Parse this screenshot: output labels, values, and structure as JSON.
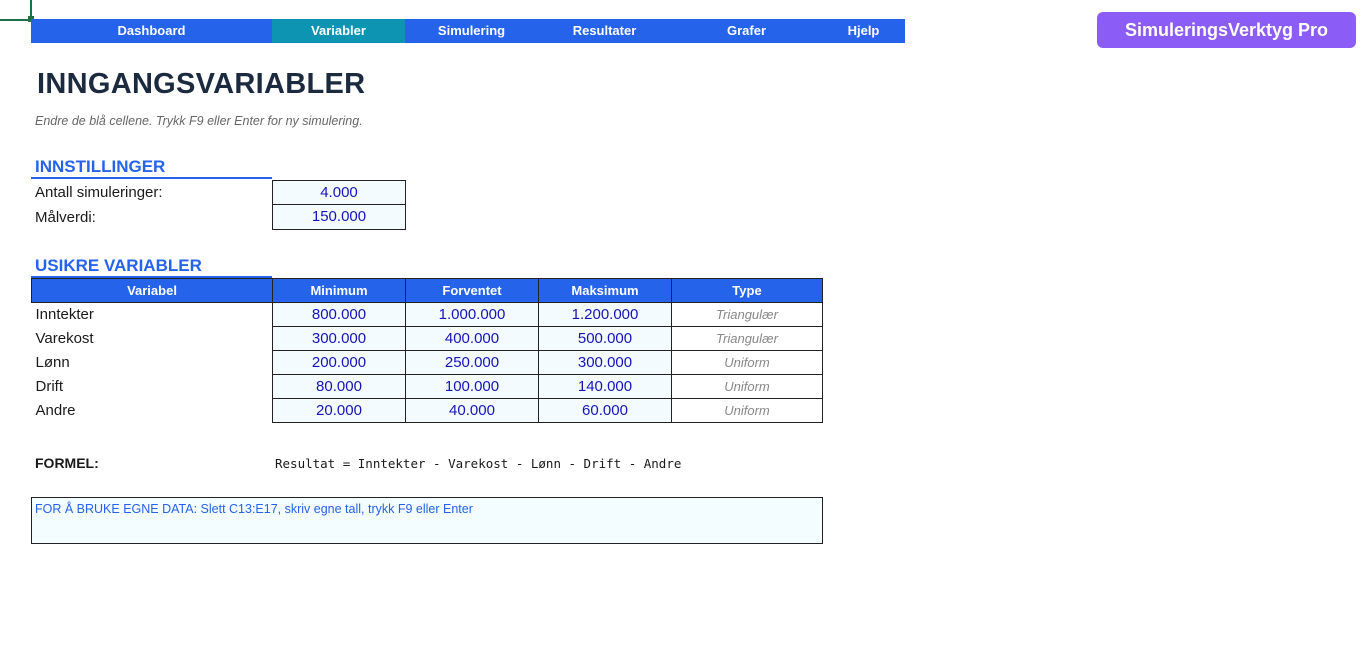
{
  "nav": {
    "items": [
      {
        "label": "Dashboard"
      },
      {
        "label": "Variabler"
      },
      {
        "label": "Simulering"
      },
      {
        "label": "Resultater"
      },
      {
        "label": "Grafer"
      },
      {
        "label": "Hjelp"
      }
    ],
    "active": "Variabler"
  },
  "brand": "SimuleringsVerktyg Pro",
  "page": {
    "title": "INNGANGSVARIABLER",
    "subtitle": "Endre de blå cellene. Trykk F9 eller Enter for ny simulering."
  },
  "settings": {
    "title": "INNSTILLINGER",
    "rows": [
      {
        "label": "Antall simuleringer:",
        "value": "4.000"
      },
      {
        "label": "Målverdi:",
        "value": "150.000"
      }
    ]
  },
  "variables": {
    "title": "USIKRE VARIABLER",
    "headers": [
      "Variabel",
      "Minimum",
      "Forventet",
      "Maksimum",
      "Type"
    ],
    "rows": [
      {
        "name": "Inntekter",
        "min": "800.000",
        "expected": "1.000.000",
        "max": "1.200.000",
        "type": "Triangulær"
      },
      {
        "name": "Varekost",
        "min": "300.000",
        "expected": "400.000",
        "max": "500.000",
        "type": "Triangulær"
      },
      {
        "name": "Lønn",
        "min": "200.000",
        "expected": "250.000",
        "max": "300.000",
        "type": "Uniform"
      },
      {
        "name": "Drift",
        "min": "80.000",
        "expected": "100.000",
        "max": "140.000",
        "type": "Uniform"
      },
      {
        "name": "Andre",
        "min": "20.000",
        "expected": "40.000",
        "max": "60.000",
        "type": "Uniform"
      }
    ]
  },
  "formula": {
    "label": "FORMEL:",
    "text": "Resultat = Inntekter - Varekost - Lønn - Drift - Andre"
  },
  "note": "FOR Å BRUKE EGNE DATA: Slett C13:E17, skriv egne tall, trykk F9 eller Enter",
  "colors": {
    "accent": "#2563eb",
    "nav_active": "#0e94b3",
    "brand": "#8b5cf6",
    "input_text": "#1414b8"
  }
}
